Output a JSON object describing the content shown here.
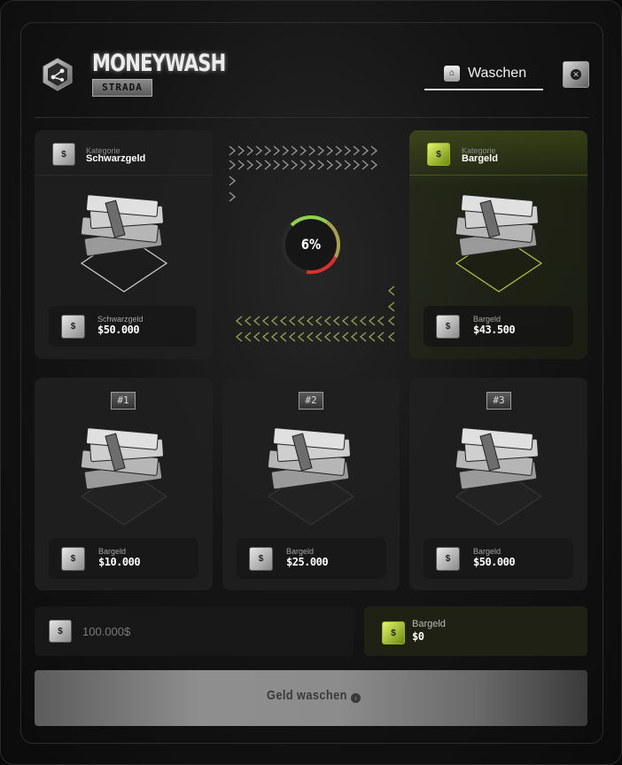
{
  "header": {
    "brand_title": "MONEYWASH",
    "brand_subtitle": "STRADA",
    "tab_label": "Waschen",
    "close_icon": "close-icon",
    "logo_icon": "network-icon"
  },
  "exchange": {
    "source": {
      "category_label": "Kategorie",
      "category_value": "Schwarzgeld",
      "amount_label": "Schwarzgeld",
      "amount_value": "$50.000"
    },
    "target": {
      "category_label": "Kategorie",
      "category_value": "Bargeld",
      "amount_label": "Bargeld",
      "amount_value": "$43.500"
    },
    "fee_percent_text": "6%",
    "fee_fraction": 0.06
  },
  "presets": [
    {
      "badge": "#1",
      "label": "Bargeld",
      "value": "$10.000"
    },
    {
      "badge": "#2",
      "label": "Bargeld",
      "value": "$25.000"
    },
    {
      "badge": "#3",
      "label": "Bargeld",
      "value": "$50.000"
    }
  ],
  "amount_input": {
    "placeholder": "100.000$"
  },
  "result": {
    "label": "Bargeld",
    "value": "$0"
  },
  "wash_button": {
    "label": "Geld waschen"
  },
  "colors": {
    "accent_green": "#9ab320",
    "progress_red": "#d8302c",
    "progress_green": "#8fd14f"
  },
  "icons": {
    "money_bag": "money-bag-icon",
    "cash_stack": "cash-stack-icon"
  }
}
